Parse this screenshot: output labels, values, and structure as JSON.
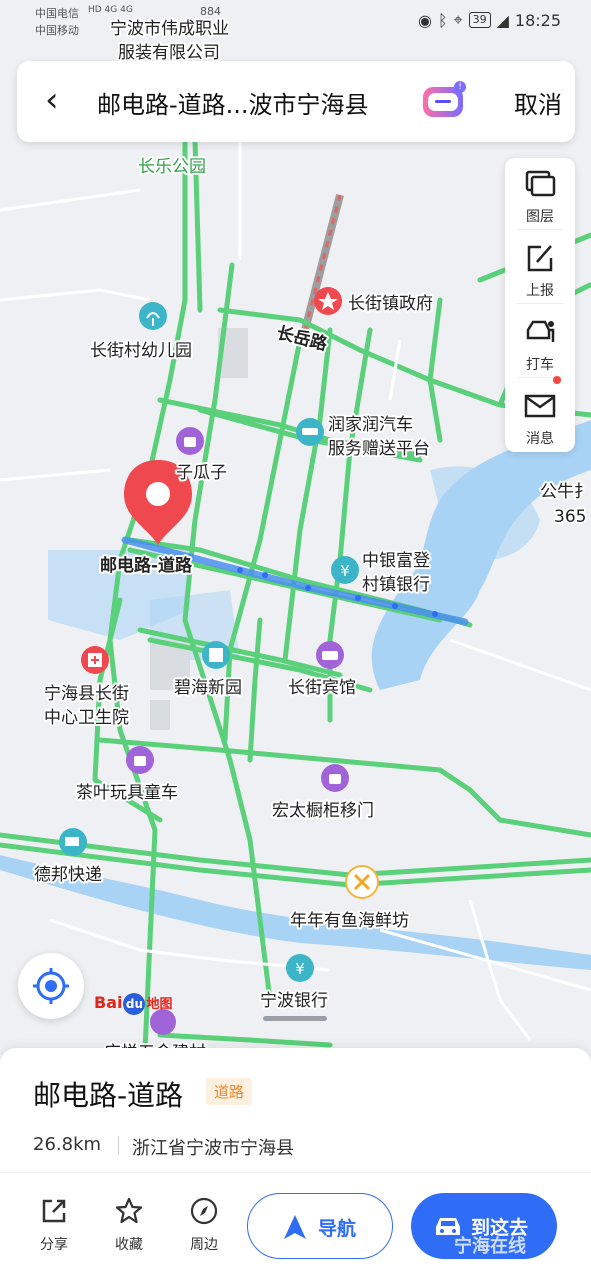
{
  "status": {
    "carrier1": "中国电信",
    "carrier2": "中国移动",
    "network_tags": "HD 4G 4G",
    "speed": "884",
    "battery": "39",
    "time": "18:25"
  },
  "search": {
    "back_label": "‹",
    "title": "邮电路-道路...波市宁海县",
    "cancel_label": "取消",
    "assistant_badge": "!"
  },
  "toolbar": {
    "layers": "图层",
    "report": "上报",
    "taxi": "打车",
    "messages": "消息"
  },
  "map": {
    "labels": {
      "top_company": "宁波市伟成职业",
      "top_company2": "服装有限公司",
      "park": "长乐公园",
      "gov": "长街镇政府",
      "road_changyue": "长岳路",
      "kindergarten": "长街村幼儿园",
      "car_service1": "润家润汽车",
      "car_service2": "服务赠送平台",
      "melon": "子瓜子",
      "gongniu1": "公牛扌",
      "gongniu2": "365",
      "selected_road": "邮电路-道路",
      "bank1": "中银富登",
      "bank2": "村镇银行",
      "hospital1": "宁海县长街",
      "hospital2": "中心卫生院",
      "bihai": "碧海新园",
      "hotel": "长街宾馆",
      "toys": "茶叶玩具童车",
      "cabinet": "宏太橱柜移门",
      "express": "德邦快递",
      "fish": "年年有鱼海鲜坊",
      "ningbo_bank": "宁波银行",
      "hardware": "应悦五金建材"
    },
    "colors": {
      "road": "#5ad07a",
      "water": "#a9d3f5",
      "pin": "#f0484f",
      "route": "#4a8ff0"
    }
  },
  "brand": {
    "bai": "Bai",
    "du": "du",
    "map_word": "地图"
  },
  "place": {
    "name": "邮电路-道路",
    "tag": "道路",
    "distance": "26.8km",
    "address": "浙江省宁波市宁海县"
  },
  "actions": {
    "share": "分享",
    "favorite": "收藏",
    "nearby": "周边",
    "navigate": "导航",
    "go": "到这去"
  },
  "watermark": "宁海在线"
}
